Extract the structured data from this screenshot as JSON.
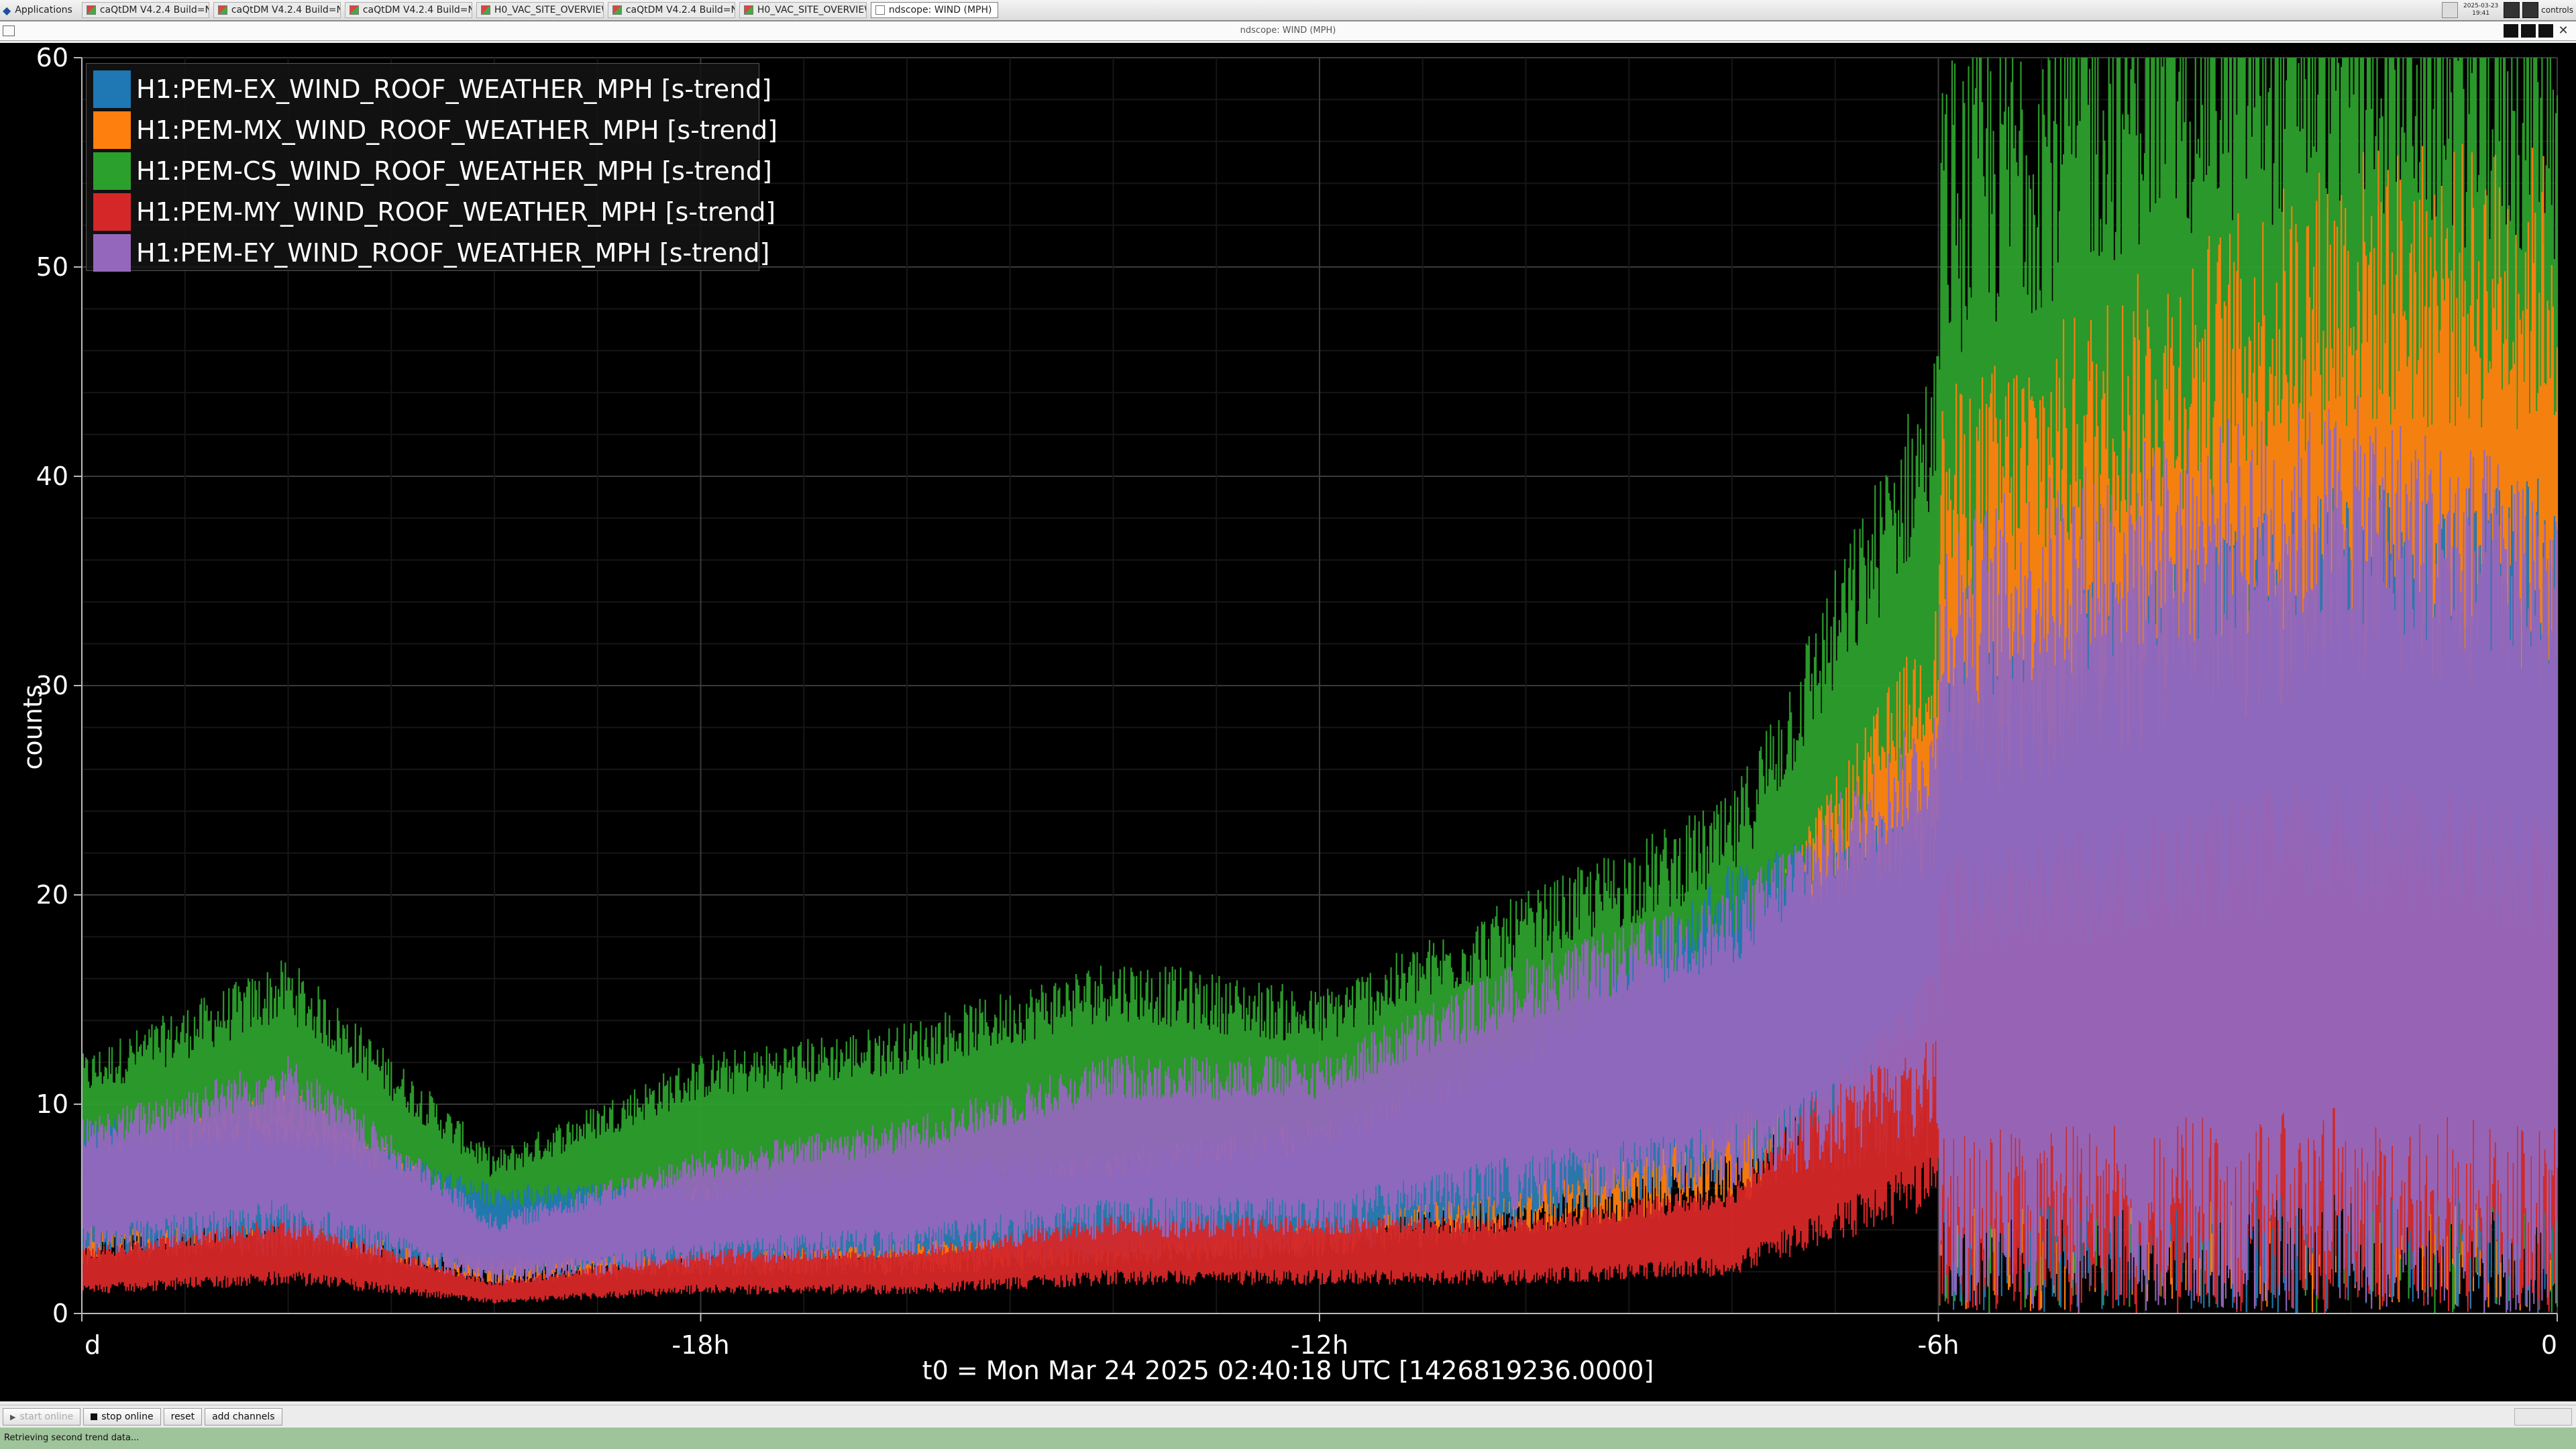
{
  "taskbar": {
    "start_label": "Applications",
    "tasks": [
      {
        "label": "caQtDM V4.2.4 Build=No..."
      },
      {
        "label": "caQtDM V4.2.4 Build=No..."
      },
      {
        "label": "caQtDM V4.2.4 Build=No..."
      },
      {
        "label": "H0_VAC_SITE_OVERVIEW_..."
      },
      {
        "label": "caQtDM V4.2.4 Build=No..."
      },
      {
        "label": "H0_VAC_SITE_OVERVIEW_..."
      },
      {
        "label": "ndscope: WIND (MPH)"
      }
    ],
    "clock_date": "2025-03-23",
    "clock_time": "19:41",
    "user": "controls"
  },
  "window": {
    "title": "ndscope: WIND (MPH)",
    "close_glyph": "✕"
  },
  "plot": {
    "legend": [
      {
        "label": "H1:PEM-EX_WIND_ROOF_WEATHER_MPH [s-trend]",
        "color": "#1f77b4"
      },
      {
        "label": "H1:PEM-MX_WIND_ROOF_WEATHER_MPH [s-trend]",
        "color": "#ff7f0e"
      },
      {
        "label": "H1:PEM-CS_WIND_ROOF_WEATHER_MPH [s-trend]",
        "color": "#2ca02c"
      },
      {
        "label": "H1:PEM-MY_WIND_ROOF_WEATHER_MPH [s-trend]",
        "color": "#d62728"
      },
      {
        "label": "H1:PEM-EY_WIND_ROOF_WEATHER_MPH [s-trend]",
        "color": "#9467bd"
      }
    ],
    "y_label": "counts",
    "y_ticks": [
      "0",
      "10",
      "20",
      "30",
      "40",
      "50",
      "60"
    ],
    "x_ticks": [
      "d",
      "-18h",
      "-12h",
      "-6h",
      "0"
    ],
    "t0_label": "t0 = Mon Mar 24 2025 02:40:18 UTC [1426819236.0000]"
  },
  "chart_data": {
    "type": "line",
    "ylim": [
      0,
      60
    ],
    "xlim_hours": [
      -24,
      0
    ],
    "x_ticks": [
      "d",
      "-18h",
      "-12h",
      "-6h",
      "0"
    ],
    "y_label": "counts",
    "grid": true,
    "legend_position": "top-left",
    "x": [
      -24,
      -22,
      -20,
      -18,
      -16,
      -14,
      -12,
      -10,
      -8,
      -6,
      -4,
      -2,
      0
    ],
    "series": [
      {
        "name": "H1:PEM-EX_WIND_ROOF_WEATHER_MPH [s-trend]",
        "values": [
          6,
          6,
          4,
          4,
          5,
          5,
          6,
          9,
          14,
          16,
          18,
          20,
          20
        ]
      },
      {
        "name": "H1:PEM-MX_WIND_ROOF_WEATHER_MPH [s-trend]",
        "values": [
          5,
          7,
          3,
          4,
          4,
          5,
          6,
          8,
          11,
          22,
          25,
          28,
          28
        ]
      },
      {
        "name": "H1:PEM-CS_WIND_ROOF_WEATHER_MPH [s-trend]",
        "values": [
          8,
          11,
          5,
          8,
          9,
          11,
          10,
          13,
          16,
          30,
          34,
          35,
          33
        ]
      },
      {
        "name": "H1:PEM-MY_WIND_ROOF_WEATHER_MPH [s-trend]",
        "values": [
          2,
          3,
          1,
          2,
          2,
          3,
          3,
          3,
          4,
          11,
          12,
          13,
          12
        ]
      },
      {
        "name": "H1:PEM-EY_WIND_ROOF_WEATHER_MPH [s-trend]",
        "values": [
          6,
          8,
          3,
          5,
          6,
          8,
          8,
          11,
          13,
          19,
          21,
          22,
          20
        ]
      }
    ]
  },
  "toolbar": {
    "resume_label": "start online",
    "stop_label": "stop online",
    "reset_label": "reset",
    "add_channels_label": "add channels"
  },
  "status": {
    "text": "Retrieving second trend data..."
  }
}
